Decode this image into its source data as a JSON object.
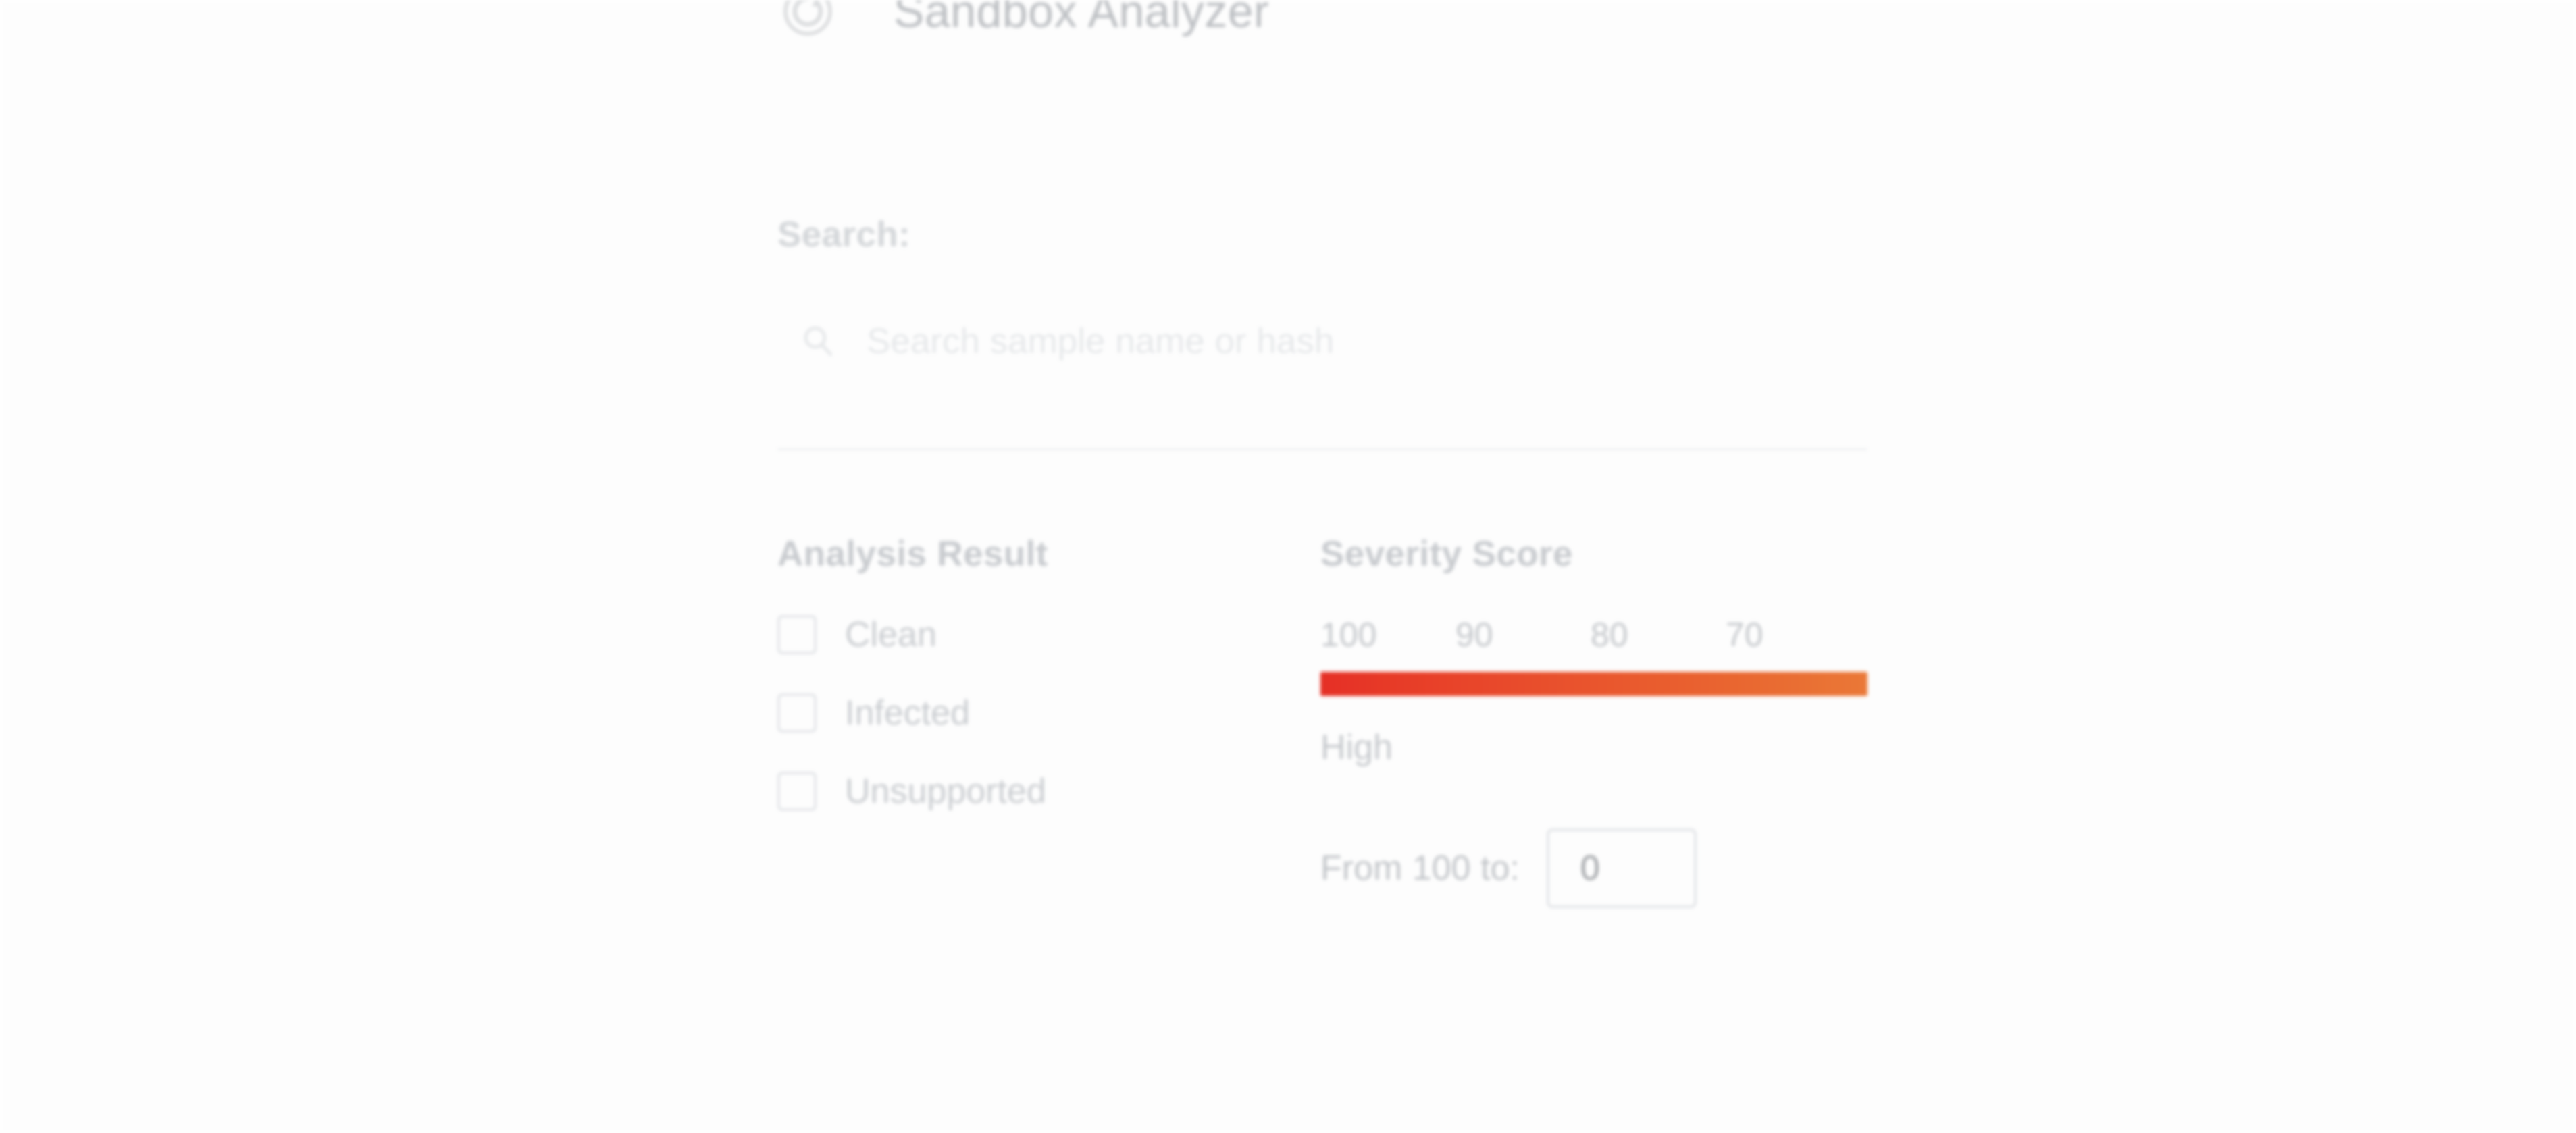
{
  "app": {
    "title": "Sandbox Analyzer",
    "icon": "refresh-circle-icon"
  },
  "search": {
    "label": "Search:",
    "placeholder": "Search sample name or hash",
    "value": "",
    "icon": "search-icon"
  },
  "filters": {
    "analysis_result": {
      "title": "Analysis Result",
      "options": [
        {
          "label": "Clean",
          "checked": false
        },
        {
          "label": "Infected",
          "checked": false
        },
        {
          "label": "Unsupported",
          "checked": false
        }
      ]
    },
    "severity_score": {
      "title": "Severity Score",
      "ticks": [
        "100",
        "90",
        "80",
        "70"
      ],
      "level_label": "High",
      "range_label": "From 100 to:",
      "range_to_value": "0",
      "gradient_start_color": "#e5281e",
      "gradient_end_color": "#eb7430"
    }
  }
}
